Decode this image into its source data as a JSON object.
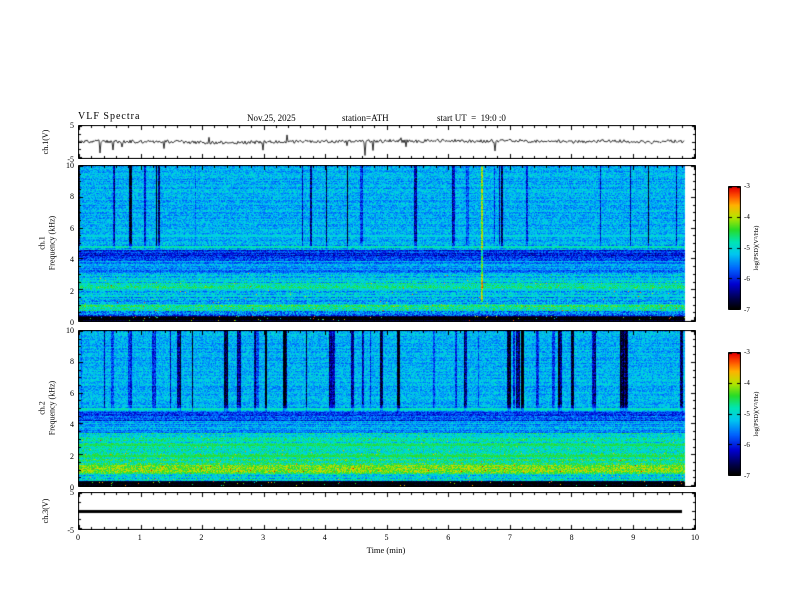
{
  "chart_data": {
    "type": "heatmap",
    "title": "VLF Spectra",
    "subtitle": {
      "date": "Nov.25, 2025",
      "station": "station=ATH",
      "start_ut": "start UT  =  19:0 :0"
    },
    "x": {
      "label": "Time (min)",
      "range": [
        0,
        10
      ],
      "ticks": [
        0,
        1,
        2,
        3,
        4,
        5,
        6,
        7,
        8,
        9,
        10
      ]
    },
    "colorbar": {
      "label": "log(PSD)(V²/Hz)",
      "range": [
        -7,
        -3
      ],
      "ticks": [
        -3,
        -4,
        -5,
        -6,
        -7
      ],
      "stops": [
        [
          0.0,
          "#000000"
        ],
        [
          0.08,
          "#00004a"
        ],
        [
          0.2,
          "#0000d0"
        ],
        [
          0.33,
          "#0064ff"
        ],
        [
          0.45,
          "#00c8f0"
        ],
        [
          0.55,
          "#00e6b4"
        ],
        [
          0.65,
          "#28dc28"
        ],
        [
          0.75,
          "#b4e600"
        ],
        [
          0.85,
          "#ffb400"
        ],
        [
          0.93,
          "#ff5000"
        ],
        [
          1.0,
          "#e60000"
        ]
      ]
    },
    "panels": [
      {
        "id": "ch1_wave",
        "kind": "line",
        "ylabel": "ch.1(V)",
        "y_range": [
          -5,
          5
        ],
        "y_ticks": [
          5,
          -5
        ],
        "end_frac": 0.985,
        "description": "Noisy broadband waveform fluctuating around 0 V with intermittent narrow negative spikes reaching about -4 V",
        "gen": {
          "seed": 11,
          "sigma": 0.5,
          "walk": 0.12,
          "neg_spike_prob": 0.012,
          "neg_spike_amp": 3.0,
          "pos_spike_prob": 0.005,
          "pos_spike_amp": 1.4
        }
      },
      {
        "id": "ch1_spec",
        "kind": "spectrogram",
        "ylabel_parts": [
          "ch.1",
          "Frequency (kHz)"
        ],
        "y_range": [
          0,
          10
        ],
        "y_ticks": [
          10,
          8,
          6,
          4,
          2,
          0
        ],
        "z_range": [
          -7,
          -3
        ],
        "seed": 7,
        "end_frac": 0.985,
        "description": "Cyan/green background PSD near -5.3 with dense dark-blue vertical dropout streaks above ~4.6 kHz, dark band 3.9-4.6 kHz, yellow-green bands near 0.8-1 and 2 kHz, black band below 0.3 kHz, orange impulsive vertical line near t=6.5 min",
        "bands": [
          {
            "f0": 0.0,
            "f1": 0.32,
            "level": -6.95,
            "noise": 0.15,
            "speck_prob": 0.02,
            "speck_amp": 2.8
          },
          {
            "f0": 0.32,
            "f1": 0.62,
            "level": -5.7,
            "noise": 0.55
          },
          {
            "f0": 0.62,
            "f1": 1.05,
            "level": -4.75,
            "noise": 0.45,
            "speck_prob": 0.004,
            "speck_amp": 1.0
          },
          {
            "f0": 1.05,
            "f1": 1.9,
            "level": -5.25,
            "noise": 0.45,
            "speck_prob": 0.005,
            "speck_amp": 1.3
          },
          {
            "f0": 1.9,
            "f1": 2.45,
            "level": -4.85,
            "noise": 0.4,
            "speck_prob": 0.006,
            "speck_amp": 1.1
          },
          {
            "f0": 2.45,
            "f1": 3.1,
            "level": -5.15,
            "noise": 0.4,
            "speck_prob": 0.003,
            "speck_amp": 1.0
          },
          {
            "f0": 3.1,
            "f1": 3.85,
            "level": -5.45,
            "noise": 0.35
          },
          {
            "f0": 3.85,
            "f1": 4.6,
            "level": -5.95,
            "noise": 0.4
          },
          {
            "f0": 4.6,
            "f1": 5.1,
            "level": -5.35,
            "noise": 0.4
          },
          {
            "f0": 5.1,
            "f1": 10.0,
            "level": -5.3,
            "noise": 0.35
          }
        ],
        "lines": [
          {
            "f": 4.78,
            "level": -4.8
          },
          {
            "f": 5.5,
            "level": -5.05
          },
          {
            "f": 1.62,
            "level": -5.0
          }
        ],
        "streaks": {
          "f_min": 4.55,
          "prob": 0.06,
          "len_min": 1,
          "len_max": 3,
          "str_min": 0.5,
          "str_max": 1.8
        },
        "events": [
          {
            "t": 6.52,
            "width": 2,
            "delta": 1.35,
            "f_min": 1.2
          }
        ]
      },
      {
        "id": "ch2_spec",
        "kind": "spectrogram",
        "ylabel_parts": [
          "ch.2",
          "Frequency (kHz)"
        ],
        "y_range": [
          0,
          10
        ],
        "y_ticks": [
          10,
          8,
          6,
          4,
          2,
          0
        ],
        "z_range": [
          -7,
          -3
        ],
        "seed": 13,
        "end_frac": 0.985,
        "description": "Similar to ch.1 but with stronger/denser blue vertical streaks above ~4.7 kHz and brighter yellow-orange horizontal banding between 0.7 and 3.4 kHz; black band below 0.3 kHz",
        "bands": [
          {
            "f0": 0.0,
            "f1": 0.3,
            "level": -6.95,
            "noise": 0.15,
            "speck_prob": 0.02,
            "speck_amp": 2.8
          },
          {
            "f0": 0.3,
            "f1": 0.72,
            "level": -5.1,
            "noise": 0.5,
            "speck_prob": 0.01,
            "speck_amp": 1.0
          },
          {
            "f0": 0.72,
            "f1": 1.45,
            "level": -4.35,
            "noise": 0.45,
            "speck_prob": 0.012,
            "speck_amp": 0.8
          },
          {
            "f0": 1.45,
            "f1": 2.3,
            "level": -4.7,
            "noise": 0.45,
            "speck_prob": 0.01,
            "speck_amp": 0.9
          },
          {
            "f0": 2.3,
            "f1": 3.4,
            "level": -4.95,
            "noise": 0.4,
            "speck_prob": 0.006,
            "speck_amp": 1.0
          },
          {
            "f0": 3.4,
            "f1": 4.2,
            "level": -5.35,
            "noise": 0.35
          },
          {
            "f0": 4.2,
            "f1": 4.75,
            "level": -5.85,
            "noise": 0.4
          },
          {
            "f0": 4.75,
            "f1": 10.0,
            "level": -5.3,
            "noise": 0.35
          }
        ],
        "lines": [
          {
            "f": 4.95,
            "level": -4.85
          },
          {
            "f": 2.62,
            "level": -4.55
          },
          {
            "f": 1.9,
            "level": -4.5
          }
        ],
        "streaks": {
          "f_min": 4.7,
          "prob": 0.075,
          "len_min": 1,
          "len_max": 4,
          "str_min": 0.6,
          "str_max": 2.0
        },
        "events": []
      },
      {
        "id": "ch3_wave",
        "kind": "line",
        "ylabel": "ch.3(V)",
        "y_range": [
          -5,
          5
        ],
        "y_ticks": [
          5,
          -5
        ],
        "constant_value": 0,
        "end_frac": 0.98,
        "description": "Flat thick black line at 0 V (no signal on channel 3)"
      }
    ]
  }
}
